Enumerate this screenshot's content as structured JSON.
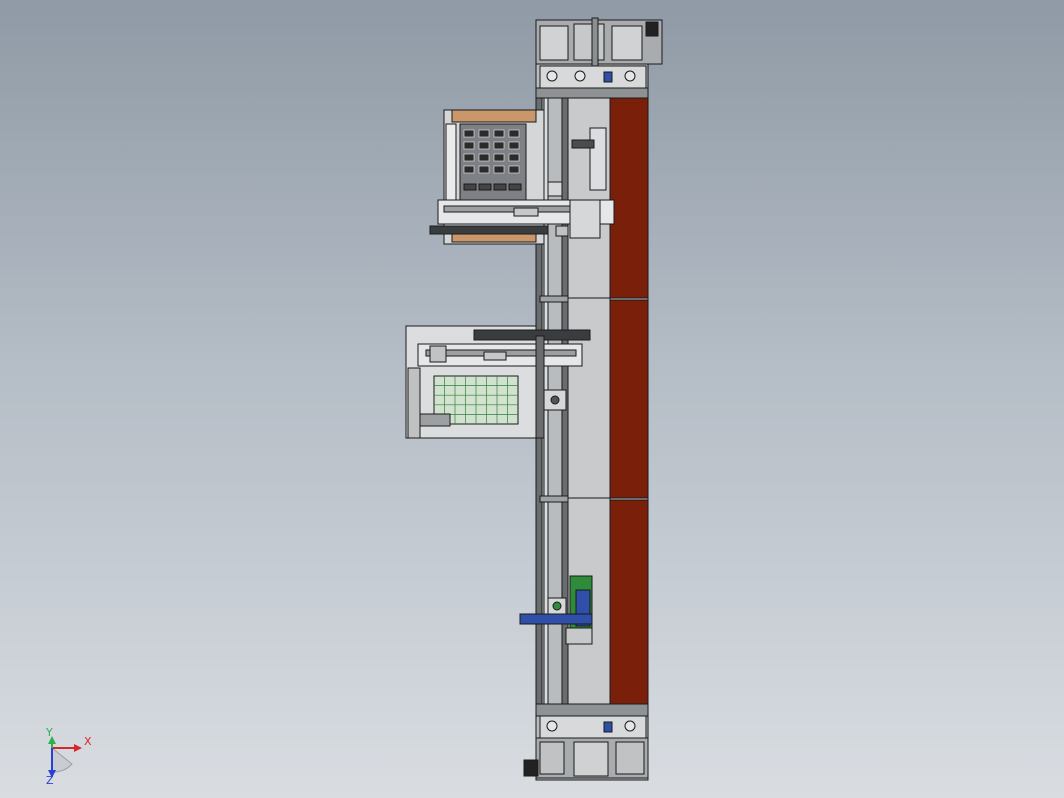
{
  "triad": {
    "x_label": "X",
    "y_label": "Y",
    "z_label": "Z",
    "x_color": "#d62828",
    "y_color": "#2bb24c",
    "z_color": "#2a3fd6"
  },
  "model": {
    "frame_color": "#b9bcbf",
    "edge_color": "#1a1a1a",
    "conveyor_belt_color": "#7a1f0a",
    "bed_color": "#c8cacc",
    "tray_cell_color": "#2b2b2b",
    "wood_color": "#c9976a",
    "green_grid_color": "#cfe3cf",
    "accent_blue": "#2f4fa8",
    "accent_green": "#2e8b3a"
  }
}
